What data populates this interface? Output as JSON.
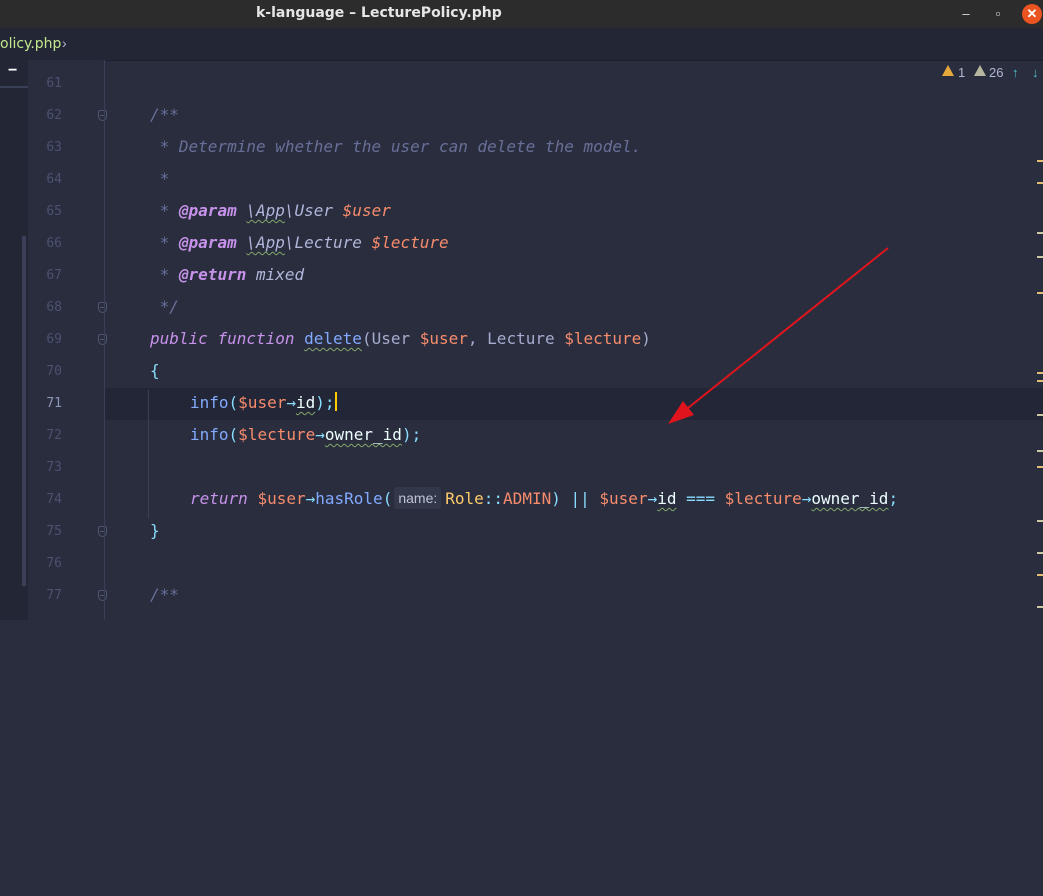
{
  "window": {
    "title": "k-language – LecturePolicy.php",
    "controls": {
      "minimize": "‒",
      "maximize": "▫",
      "close": "✕"
    }
  },
  "breadcrumb": {
    "file": "olicy.php",
    "chevron": "›"
  },
  "left_strip": {
    "collapse": "−"
  },
  "inspection": {
    "warnings": "1",
    "weak_warnings": "26",
    "up": "↑",
    "down": "↓"
  },
  "lines": [
    "61",
    "62",
    "63",
    "64",
    "65",
    "66",
    "67",
    "68",
    "69",
    "70",
    "71",
    "72",
    "73",
    "74",
    "75",
    "76",
    "77"
  ],
  "active_line": "71",
  "code": {
    "l62": "/**",
    "l63": " * Determine whether the user can delete the model.",
    "l64": " *",
    "l65_star": " * ",
    "l65_tag": "@param",
    "l65_ns": "\\App",
    "l65_type": "\\User ",
    "l65_var": "$user",
    "l66_star": " * ",
    "l66_tag": "@param",
    "l66_ns": "\\App",
    "l66_type": "\\Lecture ",
    "l66_var": "$lecture",
    "l67_star": " * ",
    "l67_tag": "@return",
    "l67_type": " mixed",
    "l68": " */",
    "l69_kw1": "public",
    "l69_kw2": "function",
    "l69_fn": "delete",
    "l69_p1": "(User ",
    "l69_v1": "$user",
    "l69_p2": ", Lecture ",
    "l69_v2": "$lecture",
    "l69_p3": ")",
    "l70": "{",
    "l71_fn": "info",
    "l71_p1": "(",
    "l71_var": "$user",
    "l71_arrow": "→",
    "l71_prop": "id",
    "l71_p2": ");",
    "l72_fn": "info",
    "l72_p1": "(",
    "l72_var": "$lecture",
    "l72_arrow": "→",
    "l72_prop": "owner_id",
    "l72_p2": ");",
    "l74_kw": "return",
    "l74_var1": "$user",
    "l74_arrow1": "→",
    "l74_fn": "hasRole",
    "l74_p1": "(",
    "l74_hint": "name:",
    "l74_class": "Role",
    "l74_dc": "::",
    "l74_const": "ADMIN",
    "l74_p2": ")",
    "l74_or": "||",
    "l74_var2": "$user",
    "l74_arrow2": "→",
    "l74_prop1": "id",
    "l74_eq": "===",
    "l74_var3": "$lecture",
    "l74_arrow3": "→",
    "l74_prop2": "owner_id",
    "l74_semi": ";",
    "l75": "}",
    "l77": "/**"
  },
  "colors": {
    "background": "#292d3e",
    "comment": "#697098",
    "keyword": "#c792ea",
    "variable": "#f78c6c",
    "function": "#82aaff",
    "annotation_arrow": "#e0141c"
  }
}
